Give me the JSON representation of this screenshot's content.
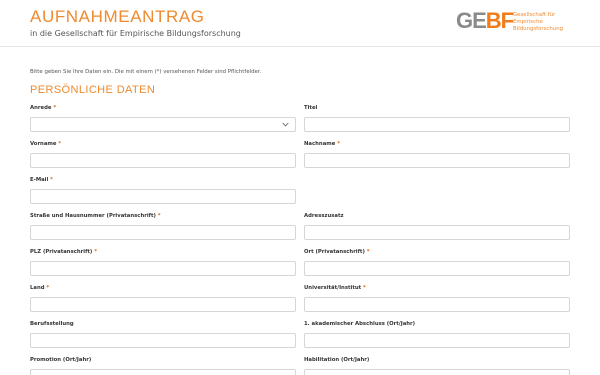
{
  "header": {
    "title": "AUFNAHMEANTRAG",
    "subtitle": "in die Gesellschaft für Empirische Bildungsforschung"
  },
  "logo": {
    "mark_left": "GE",
    "mark_right": "BF",
    "lines": [
      "Gesellschaft für",
      "Empirische",
      "Bildungsforschung"
    ]
  },
  "intro": "Bitte geben Sie Ihre Daten ein. Die mit einem (*) versehenen Felder sind Pflichtfelder.",
  "section_title": "PERSÖNLICHE DATEN",
  "required_marker": "*",
  "fields": {
    "anrede": {
      "label": "Anrede",
      "value": ""
    },
    "titel": {
      "label": "Titel",
      "value": ""
    },
    "vorname": {
      "label": "Vorname",
      "value": ""
    },
    "nachname": {
      "label": "Nachname",
      "value": ""
    },
    "email": {
      "label": "E-Mail",
      "value": ""
    },
    "strasse": {
      "label": "Straße und Hausnummer (Privatanschrift)",
      "value": ""
    },
    "adresszusatz": {
      "label": "Adresszusatz",
      "value": ""
    },
    "plz": {
      "label": "PLZ (Privatanschrift)",
      "value": ""
    },
    "ort": {
      "label": "Ort (Privatanschrift)",
      "value": ""
    },
    "land": {
      "label": "Land",
      "value": ""
    },
    "universitaet": {
      "label": "Universität/Institut",
      "value": ""
    },
    "berufsstellung": {
      "label": "Berufsstellung",
      "value": ""
    },
    "abschluss": {
      "label": "1. akademischer Abschluss (Ort/Jahr)",
      "value": ""
    },
    "promotion": {
      "label": "Promotion (Ort/Jahr)",
      "value": ""
    },
    "habilitation": {
      "label": "Habilitation (Ort/Jahr)",
      "value": ""
    }
  }
}
